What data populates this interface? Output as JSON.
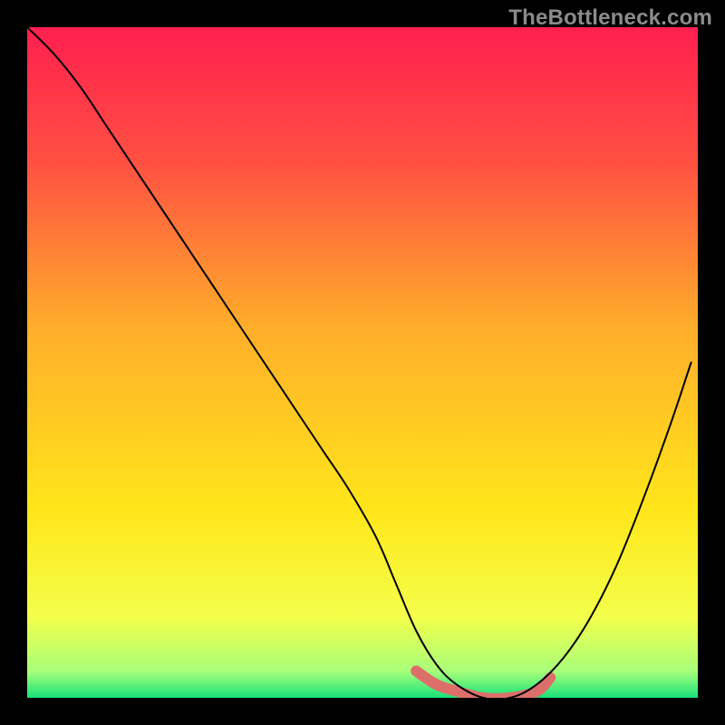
{
  "watermark": "TheBottleneck.com",
  "chart_data": {
    "type": "line",
    "title": "",
    "xlabel": "",
    "ylabel": "",
    "xlim": [
      0,
      100
    ],
    "ylim": [
      0,
      100
    ],
    "grid": false,
    "legend": false,
    "background_gradient": {
      "direction": "vertical",
      "stops": [
        {
          "pos": 0.0,
          "color": "#ff1f4f"
        },
        {
          "pos": 0.2,
          "color": "#ff5042"
        },
        {
          "pos": 0.45,
          "color": "#ffae2a"
        },
        {
          "pos": 0.72,
          "color": "#ffe61a"
        },
        {
          "pos": 0.88,
          "color": "#f3ff4a"
        },
        {
          "pos": 0.96,
          "color": "#a8ff7a"
        },
        {
          "pos": 1.0,
          "color": "#18e27a"
        }
      ]
    },
    "series": [
      {
        "name": "bottleneck-curve",
        "stroke": "#000000",
        "stroke_width": 2,
        "x": [
          0,
          4,
          8,
          12,
          16,
          20,
          24,
          28,
          32,
          36,
          40,
          44,
          48,
          52,
          55,
          58,
          61,
          64,
          68,
          72,
          76,
          80,
          84,
          88,
          92,
          96,
          99
        ],
        "y": [
          100,
          96,
          91,
          85,
          79,
          73,
          67,
          61,
          55,
          49,
          43,
          37,
          31,
          24,
          17,
          10,
          5,
          2,
          0,
          0,
          2,
          6,
          12,
          20,
          30,
          41,
          50
        ]
      },
      {
        "name": "highlight-band",
        "stroke": "#dd6f6a",
        "stroke_width": 12,
        "linecap": "round",
        "x": [
          58,
          61,
          64,
          68,
          72,
          76,
          78
        ],
        "y": [
          4,
          2,
          1,
          0,
          0,
          1,
          3
        ]
      }
    ]
  }
}
